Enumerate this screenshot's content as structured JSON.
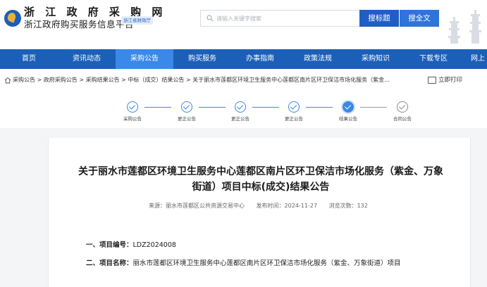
{
  "header": {
    "title": "浙 江 政 府 采 购 网",
    "subtitle": "浙江政府购买服务信息平台",
    "badge": "浙江省财政厅",
    "search_placeholder": "请输入关键字搜索",
    "btn_title": "搜标题",
    "btn_all": "搜全文"
  },
  "nav": {
    "items": [
      "首页",
      "资讯动态",
      "采购公告",
      "购买服务",
      "办事指南",
      "政策法规",
      "采购知识",
      "下载专区",
      "网上"
    ],
    "active_index": 2
  },
  "breadcrumb": {
    "path": "采购公告 > 政府采购公告 > 采购结果公告 > 中标（成交）结果公告 > 关于丽水市莲都区环境卫生服务中心莲都区南片区环卫保洁市场化服务（紫金...",
    "print_label": "立即打印"
  },
  "progress": {
    "steps": [
      "采购公告",
      "更正公告",
      "更正公告",
      "更正公告",
      "结果公告",
      "合同公告"
    ],
    "current_index": 4
  },
  "article": {
    "title": "关于丽水市莲都区环境卫生服务中心莲都区南片区环卫保洁市场化服务（紫金、万象街道）项目中标(成交)结果公告",
    "source": "来源：丽水市莲都区公共资源交易中心",
    "publish_time": "发布时间：2024-11-27",
    "views": "浏览次数：132",
    "sec1_label": "一、项目编号：",
    "sec1_value": "LDZ2024008",
    "sec2_label": "二、项目名称：",
    "sec2_value": "丽水市莲都区环境卫生服务中心莲都区南片区环卫保洁市场化服务（紫金、万象街道）项目"
  },
  "colors": {
    "brand_blue": "#1c5fb8",
    "nav_active": "#3a88e8"
  }
}
